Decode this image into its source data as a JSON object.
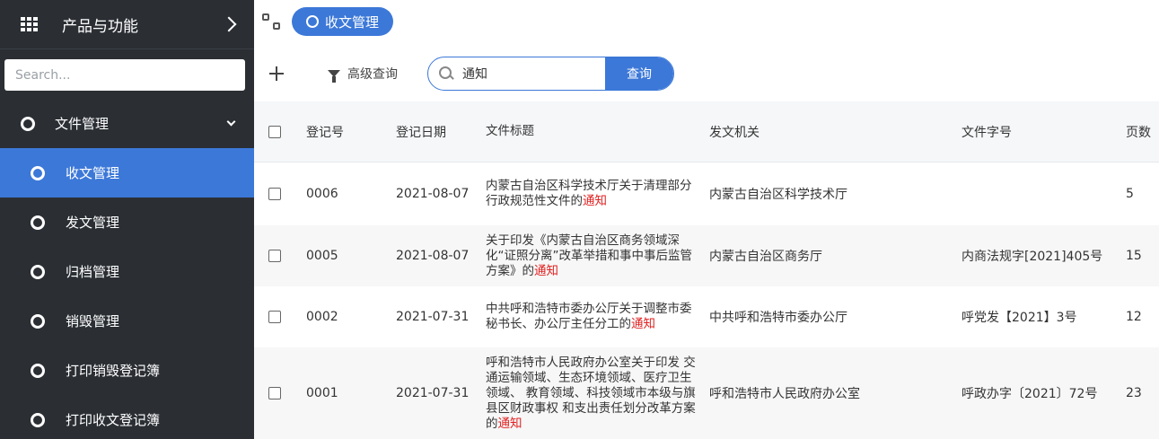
{
  "sidebar": {
    "title": "产品与功能",
    "search_placeholder": "Search...",
    "group": {
      "label": "文件管理"
    },
    "items": [
      {
        "label": "收文管理",
        "active": true
      },
      {
        "label": "发文管理"
      },
      {
        "label": "归档管理"
      },
      {
        "label": "销毁管理"
      },
      {
        "label": "打印销毁登记簿"
      },
      {
        "label": "打印收文登记簿"
      }
    ]
  },
  "topbar": {
    "active_tab": "收文管理"
  },
  "toolbar": {
    "advanced_search": "高级查询",
    "search_value": "通知",
    "search_button": "查询"
  },
  "table": {
    "columns": [
      "登记号",
      "登记日期",
      "文件标题",
      "发文机关",
      "文件字号",
      "页数"
    ],
    "rows": [
      {
        "no": "0006",
        "date": "2021-08-07",
        "title_prefix": "内蒙古自治区科学技术厅关于清理部分行政规范性文件的",
        "title_hl": "通知",
        "org": "内蒙古自治区科学技术厅",
        "docno": "",
        "pages": "5"
      },
      {
        "no": "0005",
        "date": "2021-08-07",
        "title_prefix": "关于印发《内蒙古自治区商务领域深化“证照分离”改革举措和事中事后监管方案》的",
        "title_hl": "通知",
        "org": "内蒙古自治区商务厅",
        "docno": "内商法规字[2021]405号",
        "pages": "15"
      },
      {
        "no": "0002",
        "date": "2021-07-31",
        "title_prefix": "中共呼和浩特市委办公厅关于调整市委秘书长、办公厅主任分工的",
        "title_hl": "通知",
        "org": "中共呼和浩特市委办公厅",
        "docno": "呼党发【2021】3号",
        "pages": "12"
      },
      {
        "no": "0001",
        "date": "2021-07-31",
        "title_prefix": "呼和浩特市人民政府办公室关于印发 交通运输领域、生态环境领域、医疗卫生领域、 教育领域、科技领域市本级与旗县区财政事权 和支出责任划分改革方案的",
        "title_hl": "通知",
        "org": "呼和浩特市人民政府办公室",
        "docno": "呼政办字〔2021〕72号",
        "pages": "23"
      }
    ]
  }
}
